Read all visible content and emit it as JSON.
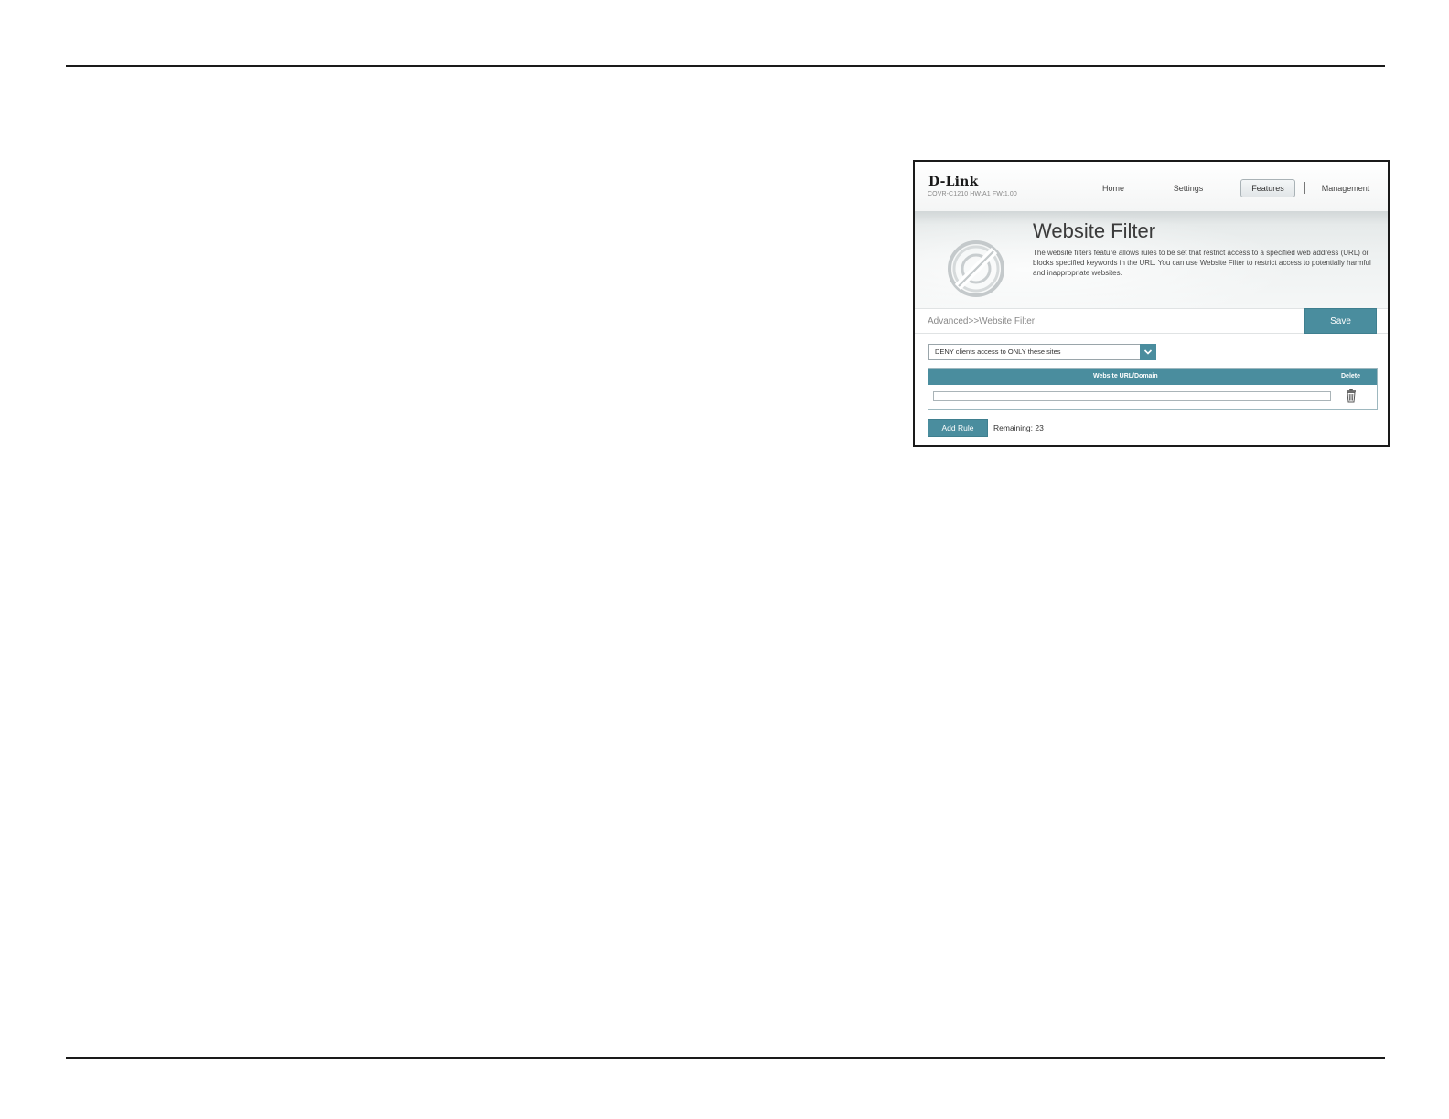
{
  "app": {
    "brand": "D-Link",
    "model_info": "COVR-C1210 HW:A1 FW:1.00"
  },
  "nav": {
    "home": "Home",
    "settings": "Settings",
    "features": "Features",
    "management": "Management",
    "active": "Features"
  },
  "banner": {
    "title": "Website Filter",
    "description": "The website filters feature allows rules to be set that restrict access to a specified web address (URL) or blocks specified keywords in the URL. You can use Website Filter to restrict access to potentially harmful and inappropriate websites.",
    "icon": "no-entry-icon"
  },
  "toolbar": {
    "breadcrumb": "Advanced>>Website Filter",
    "save_label": "Save"
  },
  "filter_mode": {
    "selected": "DENY clients access to ONLY these sites"
  },
  "rules_table": {
    "columns": [
      "Website URL/Domain",
      "Delete"
    ],
    "rows": [
      {
        "url": ""
      }
    ]
  },
  "footer": {
    "add_rule_label": "Add Rule",
    "remaining_label": "Remaining:",
    "remaining_count": "23"
  },
  "colors": {
    "accent": "#4a8d9e",
    "rule_line": "#1a1a1a"
  }
}
